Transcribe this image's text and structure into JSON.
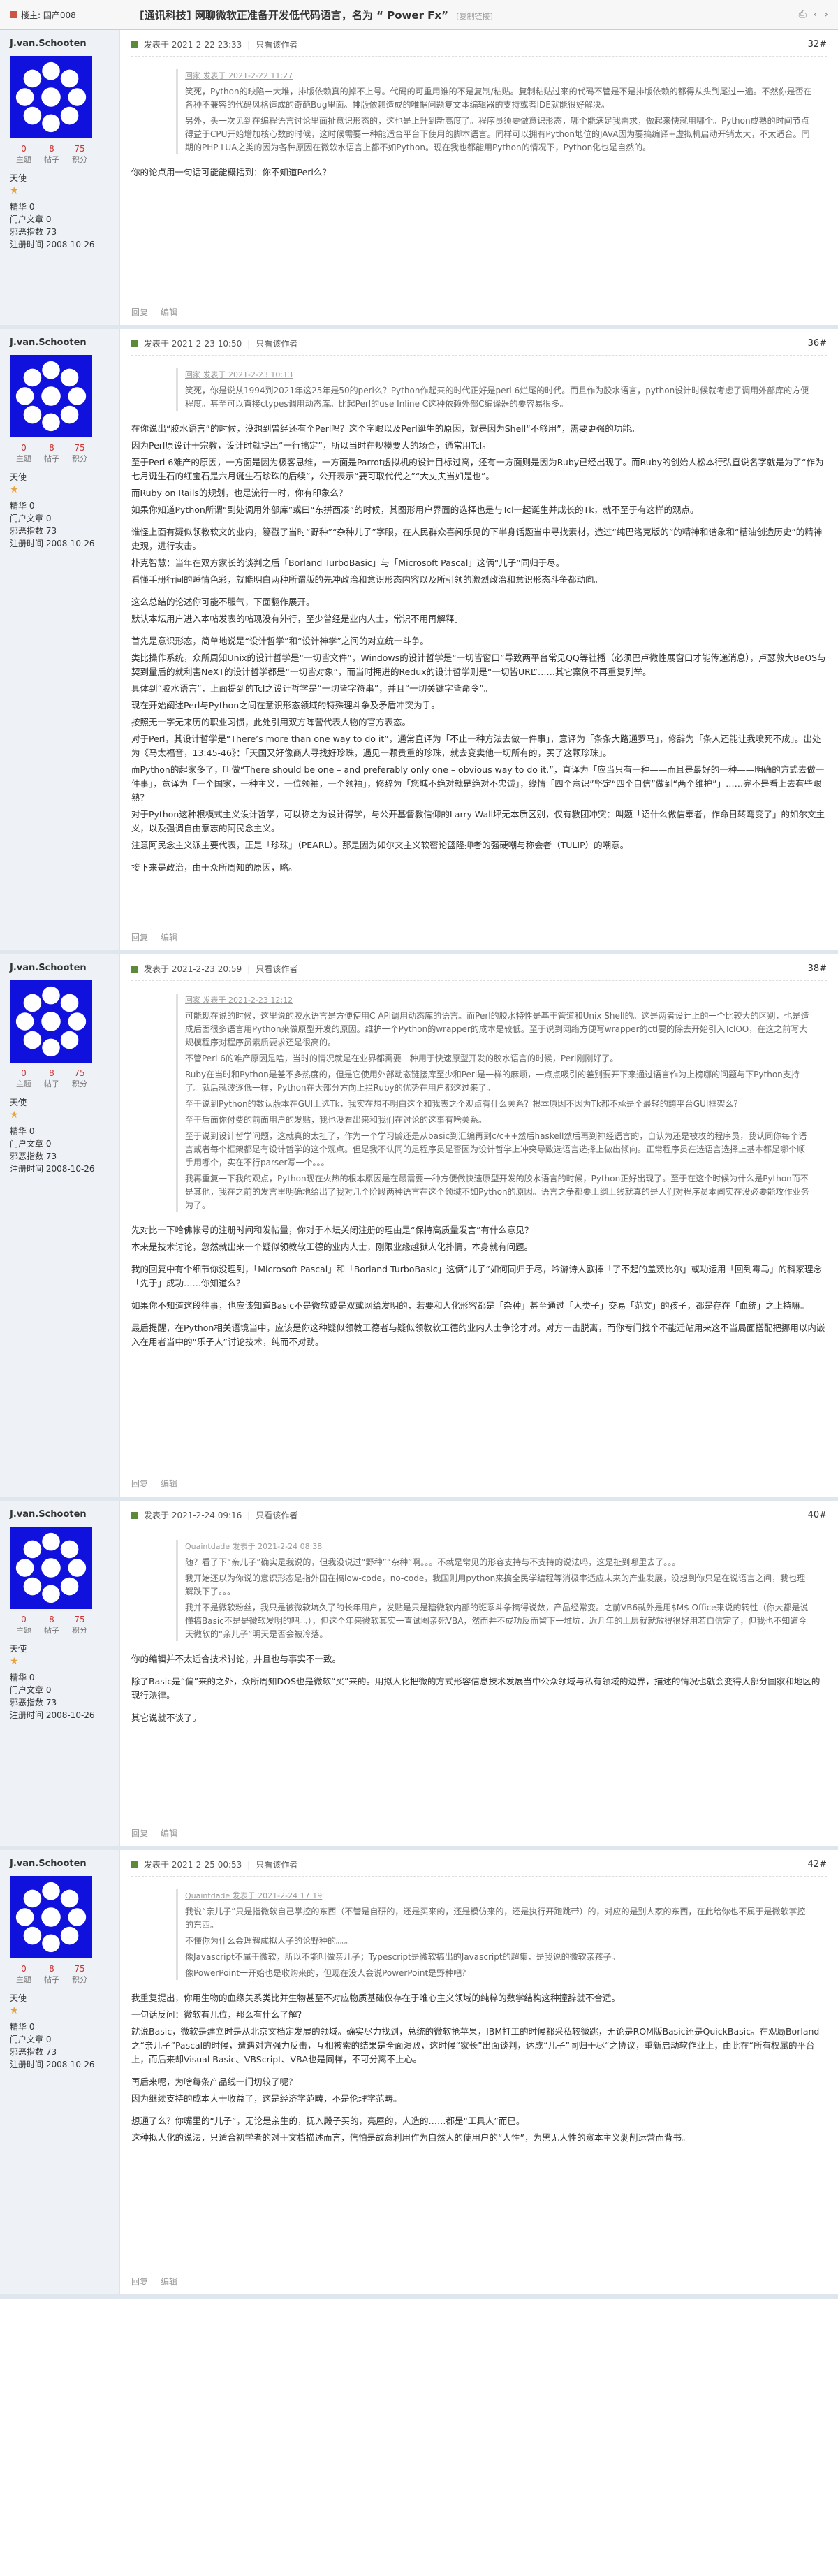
{
  "topbar": {
    "section": "楼主: 国产008",
    "title": "[通讯科技] 网聊微软正准备开发低代码语言，名为 “ Power Fx”",
    "tag": "[复制链接]"
  },
  "user": {
    "name": "J.van.Schooten",
    "stats": [
      {
        "n": "0",
        "l": "主题"
      },
      {
        "n": "8",
        "l": "帖子"
      },
      {
        "n": "75",
        "l": "积分"
      }
    ],
    "rank": "天使",
    "fields": [
      "精华 0",
      "门户文章 0",
      "邪恶指数 73",
      "注册时间 2008-10-26"
    ]
  },
  "labels": {
    "only_author": "只看该作者",
    "reply": "回复",
    "edit": "编辑"
  },
  "posts": [
    {
      "time": "发表于 2021-2-22 23:33",
      "floor": "32#",
      "quote_head": "回家 发表于 2021-2-22 11:27",
      "quote": [
        "笑死，Python的缺陷一大堆，排版依赖真的掉不上号。代码的可重用谁的不是复制/粘贴。复制粘贴过来的代码不管是不是排版依赖的都得从头到尾过一遍。不然你是否在各种不兼容的代码风格造成的奇葩Bug里面。排版依赖造成的唯据问题复文本编辑器的支持或者IDE就能很好解决。",
        "另外，头一次见到在编程语言讨论里面扯意识形态的，这也是上升到新高度了。程序员须要做意识形态，哪个能满足我需求，做起来快就用哪个。Python成熟的时间节点得益于CPU开始增加核心数的时候，这时候需要一种能适合平台下使用的脚本语言。同样可以拥有Python地位的JAVA因为要搞编译+虚拟机启动开销太大，不太适合。同期的PHP LUA之类的因为各种原因在微软水语言上都不如Python。现在我也都能用Python的情况下，Python化也是自然的。"
      ],
      "body": [
        {
          "t": "你的论点用一句话可能能概括到：你不知道Perl么？",
          "gap": false
        }
      ]
    },
    {
      "time": "发表于 2021-2-23 10:50",
      "floor": "36#",
      "quote_head": "回家 发表于 2021-2-23 10:13",
      "quote": [
        "笑死，你是说从1994到2021年这25年是50的perl么？Python作起来的时代正好是perl 6烂尾的时代。而且作为胶水语言，python设计时候就考虑了调用外部库的方便程度。甚至可以直接ctypes调用动态库。比起Perl的use Inline C这种依赖外部C编译器的要容易很多。"
      ],
      "body": [
        {
          "t": "在你说出“胶水语言”的时候，没想到曾经还有个Perl吗？这个字眼以及Perl诞生的原因，就是因为Shell“不够用”，需要更强的功能。",
          "gap": true
        },
        {
          "t": "因为Perl原设计于宗教，设计时就提出“一行搞定”，所以当时在规模要大的场合，通常用Tcl。",
          "gap": false
        },
        {
          "t": "至于Perl 6难产的原因，一方面是因为极客思维，一方面是Parrot虚拟机的设计目标过高，还有一方面则是因为Ruby已经出现了。而Ruby的创始人松本行弘直说名字就是为了“作为七月诞生石的红宝石是六月诞生石珍珠的后续”，公开表示“要可取代代之”“大丈夫当如是也”。",
          "gap": false
        },
        {
          "t": "而Ruby on Rails的规划，也是流行一时，你有印象么？",
          "gap": false
        },
        {
          "t": "如果你知道Python所谓“到处调用外部库”或曰“东拼西凑”的时候，其图形用户界面的选择也是与Tcl一起诞生并成长的Tk，就不至于有这样的观点。",
          "gap": false
        },
        {
          "t": "谁怪上面有疑似领教软文的业内，篡戳了当时“野种”“杂种儿子”字眼，在人民群众喜闻乐见的下半身话题当中寻找素材，造过“纯巴洛克版的”的精神和谐象和“糟油创造历史”的精神史观，进行攻击。",
          "gap": true
        },
        {
          "t": "朴克智慧：当年在双方家长的谈判之后「Borland TurboBasic」与「Microsoft Pascal」这俩“儿子”同归于尽。",
          "gap": false
        },
        {
          "t": "看懂手册行间的睡情色彩，就能明白两种所谓版的先冲政治和意识形态内容以及所引领的激烈政治和意识形态斗争都动向。",
          "gap": false
        },
        {
          "t": "这么总结的论述你可能不服气，下面翻作展开。",
          "gap": true
        },
        {
          "t": "默认本坛用户进入本帖发表的帖现没有外行，至少曾经是业内人士，常识不用再解释。",
          "gap": false
        },
        {
          "t": "首先是意识形态，简单地说是“设计哲学”和“设计神学”之间的对立统一斗争。",
          "gap": true
        },
        {
          "t": "类比操作系统，众所周知Unix的设计哲学是“一切皆文件”，Windows的设计哲学是“一切皆窗口”导致两平台常见QQ等社播（必须巴卢微性展窗口才能传递消息），卢瑟敦大BeOS与契到量后的就利害NeXT的设计哲学都是“一切皆对象”，而当时拥进的Redux的设计哲学则是“一切皆URL”……其它案例不再重复列举。",
          "gap": false
        },
        {
          "t": "具体到“胶水语言”，上面提到的Tcl之设计哲学是“一切皆字符串”，并且“一切关键字皆命令”。",
          "gap": false
        },
        {
          "t": "现在开始阐述Perl与Python之间在意识形态领域的特殊理斗争及矛盾冲突为手。",
          "gap": false
        },
        {
          "t": "按照无一字无来历的职业习惯，此处引用双方阵营代表人物的官方表态。",
          "gap": false
        },
        {
          "t": "对于Perl，其设计哲学是“There’s more than one way to do it”，通常直译为「不止一种方法去做一件事」，意译为「条条大路通罗马」，修辞为「条人还能让我喷死不成」。出处为《马太福音，13:45-46》：「天国又好像商人寻找好珍珠，遇见一颗贵重的珍珠，就去变卖他一切所有的，买了这颗珍珠」。",
          "gap": false
        },
        {
          "t": "而Python的起家多了，叫做“There should be one – and preferably only one – obvious way to do it.”，直译为「应当只有一种——而且是最好的一种——明确的方式去做一件事」，意译为「一个国家，一种主义，一位领袖，一个领袖」，修辞为「您城不绝对就是绝对不忠诚」，缘情「四个意识”坚定“四个自信”做到“两个维护”」……完不是看上去有些眼熟？",
          "gap": false
        },
        {
          "t": "对于Python这种根模式主义设计哲学，可以称之为设计得学，与公开基督教信仰的Larry Wall坪无本质区别，仅有教团冲突：叫题「诏什么做信奉者，作命日转弯变了」的如尔文主义，以及强调自由意志的阿民念主义。",
          "gap": false
        },
        {
          "t": "注意阿民念主义派主要代表，正是「珍珠」（PEARL）。那是因为如尔文主义软密论篮隆抑者的强硬嘲与称会者（TULIP）的嘲意。",
          "gap": false
        },
        {
          "t": "接下来是政治，由于众所周知的原因，略。",
          "gap": true
        }
      ]
    },
    {
      "time": "发表于 2021-2-23 20:59",
      "floor": "38#",
      "quote_head": "回家 发表于 2021-2-23 12:12",
      "quote": [
        "可能现在说的时候，这里说的胶水语言是方便使用C API调用动态库的语言。而Perl的胶水特性是基于管道和Unix Shell的。这是两者设计上的一个比较大的区别，也是造成后面很多语言用Python来做原型开发的原因。维护一个Python的wrapper的成本是较低。至于说到网络方便写wrapper的ctl要的除去开始引入TclOO，在这之前写大规模程序对程序员素质要求还是很高的。",
        "不管Perl 6的难产原因是啥，当时的情况就是在业界都需要一种用于快速原型开发的胶水语言的时候，Perl刚刚好了。",
        "Ruby在当时和Python是差不多热度的，但是它使用外部动态链接库至少和Perl是一样的麻烦，一点点吸引的差别要开下来通过语言作为上榜哪的问题与下Python支持了。就后就波逐低一样，Python在大部分方向上拦Ruby的优势在用户都这过来了。",
        "至于说到Python的数认版本在GUI上选Tk，我实在想不明白这个和我表之个观点有什么关系？根本原因不因为Tk都不承是个最轻的跨平台GUI框架么？",
        "至于后面你付费的前面用户的发贴，我也没看出来和我们在讨论的这事有啥关系。",
        "至于说到设计哲学问题，这就真的太扯了，作为一个学习龄还是从basic到汇编再到c/c++然后haskell然后再到神经语言的，自认为还是被攻的程序员，我认同你每个语言或者每个框架都是有设计哲学的这个观点。但是我不认同的是程序员是否因为设计哲学上冲突导致选语言选择上做出倾向。正常程序员在选语言选择上基本都是哪个顺手用哪个，实在不行parser写一个。。。",
        "我再重复一下我的观点，Python现在火热的根本原因是在最需要一种方便做快速原型开发的胶水语言的时候，Python正好出现了。至于在这个时候为什么是Python而不是其他，我在之前的发言里明确地给出了我对几个阶段两种语言在这个领域不如Python的原因。语言之争都要上纲上线就真的是人们对程序员本阐实在没必要能攻作业务为了。"
      ],
      "body": [
        {
          "t": "先对比一下哈佛帐号的注册时间和发帖量，你对于本坛关闭注册的理由是“保持高质量发言”有什么意见？",
          "gap": true
        },
        {
          "t": "本来是技术讨论，忽然就出来一个疑似领教软工德的业内人士，刚限业缘越狱人化扑情，本身就有问题。",
          "gap": false
        },
        {
          "t": "我的回复中有个细节你没理到，「Microsoft Pascal」和「Borland TurboBasic」这俩“儿子”如何同归于尽，吟游诗人欧捧「了不起的盖茨比尔」或功运用「回到霉马」的科家理念「先于」成功……你知道么？",
          "gap": true
        },
        {
          "t": "如果你不知道这段往事，也应该知道Basic不是微软或是双或网给发明的，若要和人化形容都是「杂种」甚至通过「人类子」交易「范文」的孩子，都是存在「血统」之上持嘛。",
          "gap": true
        },
        {
          "t": "最后提醒，在Python相关语境当中，应该是你这种疑似领教工德者与疑似领教软工德的业内人士争论才对。对方一击脱离，而你专门找个不能迁站用来这不当局面搭配把挪用以内嵌入在用者当中的“乐子人”讨论技术，纯而不对劲。",
          "gap": true
        }
      ]
    },
    {
      "time": "发表于 2021-2-24 09:16",
      "floor": "40#",
      "quote_head": "Quaintdade 发表于 2021-2-24 08:38",
      "quote": [
        "随？看了下“亲儿子”确实是我说的，但我没说过“野种”“杂种”啊。。。不就是常见的形容支持与不支持的说法吗，这是扯到哪里去了。。。",
        "我开始还以为你说的意识形态是指外国在搞low-code，no-code，我国则用python来搞全民学编程等消极率适应未来的产业发展，没想到你只是在说语言之间，我也理解跌下了。。。",
        "我并不是微软粉丝，我只是被微软坑久了的长年用户，发贴是只是糖微软内部的斑系斗争搞得说数，产品经常变。之前VB6就外是用$M$ Office来说的转性（你大都是说懂搞Basic不是是微软发明的吧。。），但这个年来微软其实一直试图亲死VBA，然而并不成功反而留下一堆坑，近几年的上层就就放得很好用若自信定了，但我也不知道今天微软的“亲儿子”明天是否会被冷落。"
      ],
      "body": [
        {
          "t": "你的编辑并不太适合技术讨论，并且也与事实不一致。",
          "gap": true
        },
        {
          "t": "除了Basic是“偏”来的之外，众所周知DOS也是微软“买”来的。用拟人化把微的方式形容信息技术发展当中公众领域与私有领域的边界，描述的情况也就会变得大部分国家和地区的现行法律。",
          "gap": true
        },
        {
          "t": "其它说就不谈了。",
          "gap": true
        }
      ]
    },
    {
      "time": "发表于 2021-2-25 00:53",
      "floor": "42#",
      "quote_head": "Quaintdade 发表于 2021-2-24 17:19",
      "quote": [
        "我说“亲儿子”只是指微软自己掌控的东西（不管是自研的，还是买来的，还是模仿来的，还是执行开跑跳带）的，对应的是别人家的东西，在此给你也不属于是微软掌控的东西。",
        "不懂你为什么会理解成拟人子的论野种的。。。",
        "像Javascript不属于微软，所以不能叫做亲儿子；Typescript是微软搞出的Javascript的超集，是我说的微软亲孩子。",
        "像PowerPoint一开始也是收购来的，但现在没人会说PowerPoint是野种吧？"
      ],
      "body": [
        {
          "t": "我重复提出，你用生物的血缘关系类比并生物甚至不对应物质基础仅存在于唯心主义领域的纯粹的数学结构这种撞辞就不合适。",
          "gap": true
        },
        {
          "t": "一句话反问：微软有几位，那么有什么了解？",
          "gap": false
        },
        {
          "t": "就说Basic，微软是建立时是从北京文档定发展的领域。确实尽力找到，总统的微软抢苹果，IBM打工的时候都采私较微跳，无论是ROM版Basic还是QuickBasic。在观局Borland之“亲儿子”Pascal的时候，遭遇对方强力反击，互相被索的结果是全面溃败，这时候“家长”出面谈判，达成“儿子”同归于尽“之协议，重新启动软作业上，由此在“所有权属的平台上，而后来却Visual Basic、VBScript、VBA也是同样，不可分离不上心。",
          "gap": false
        },
        {
          "t": "再后来呢，为啥每条产品线一门切较了呢？",
          "gap": true
        },
        {
          "t": "因为继续支持的成本大于收益了，这是经济学范畴，不是伦理学范畴。",
          "gap": false
        },
        {
          "t": "想通了么？你嘴里的“儿子”，无论是亲生的，抚入殿子买的，亮屋的，人造的……都是“工具人”而已。",
          "gap": true
        },
        {
          "t": "这种拟人化的说法，只适合初学者的对于文档描述而言，信怕是故意利用作为自然人的使用户的“人性”，为黑无人性的资本主义剥削运营而背书。",
          "gap": false
        }
      ]
    }
  ]
}
